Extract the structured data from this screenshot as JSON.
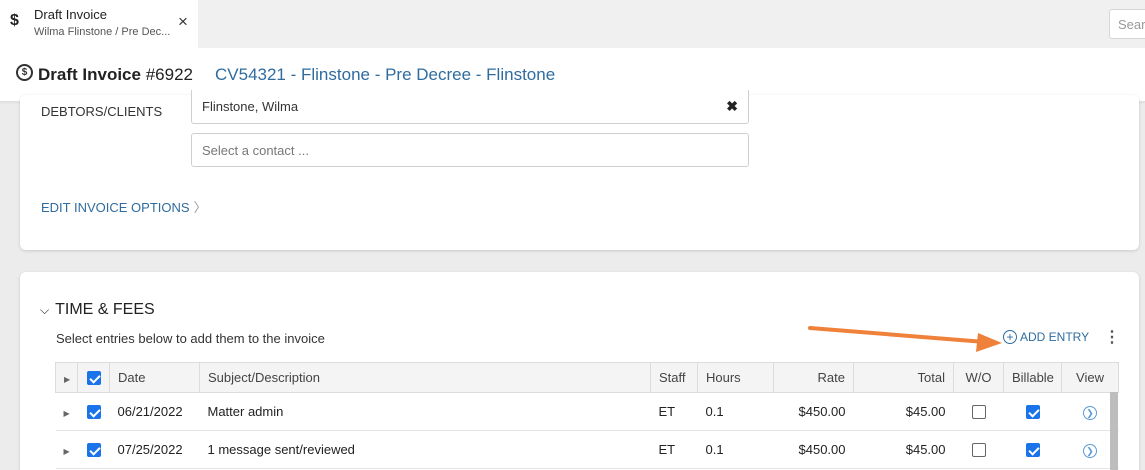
{
  "tab": {
    "icon": "dollar-icon",
    "title": "Draft Invoice",
    "subtitle": "Wilma Flinstone / Pre Dec...",
    "close": "×"
  },
  "search": {
    "placeholder": "Sear"
  },
  "header": {
    "title_prefix": "Draft Invoice ",
    "number": "#6922",
    "matter": "CV54321 - Flinstone - Pre Decree - Flinstone"
  },
  "debtors": {
    "label": "DEBTORS/CLIENTS",
    "selected": "Flinstone, Wilma",
    "contact_placeholder": "Select a contact ...",
    "clear": "✖"
  },
  "edit_options": {
    "label": "EDIT INVOICE OPTIONS",
    "chevron": "〉"
  },
  "time_fees": {
    "title": "TIME & FEES",
    "subtitle": "Select entries below to add them to the invoice",
    "add_entry": "ADD ENTRY",
    "columns": [
      "Date",
      "Subject/Description",
      "Staff",
      "Hours",
      "Rate",
      "Total",
      "W/O",
      "Billable",
      "View"
    ],
    "rows": [
      {
        "selected": true,
        "date": "06/21/2022",
        "subject": "Matter admin",
        "staff": "ET",
        "hours": "0.1",
        "rate": "$450.00",
        "total": "$45.00",
        "wo": false,
        "billable": true
      },
      {
        "selected": true,
        "date": "07/25/2022",
        "subject": "1 message sent/reviewed",
        "staff": "ET",
        "hours": "0.1",
        "rate": "$450.00",
        "total": "$45.00",
        "wo": false,
        "billable": true
      }
    ]
  },
  "colors": {
    "link": "#2f6c9f",
    "checkbox": "#1a73e8",
    "arrow": "#f0813a"
  }
}
